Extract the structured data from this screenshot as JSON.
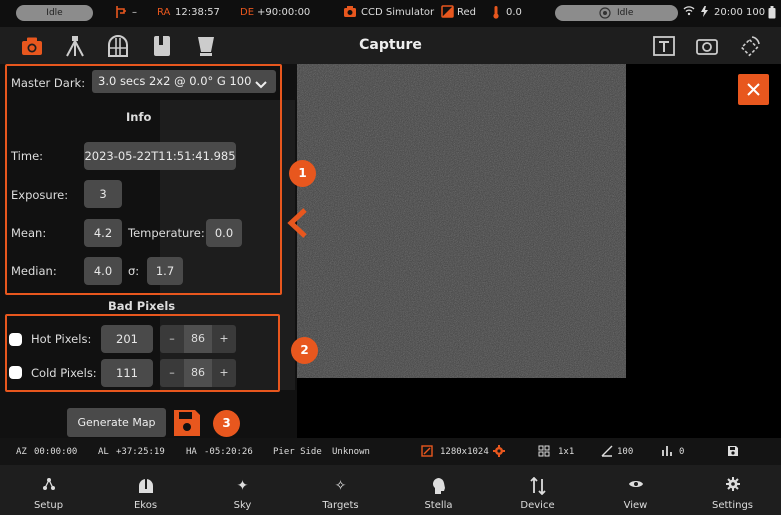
{
  "status": {
    "mount_state": "Idle",
    "ra_label": "RA",
    "ra_value": "12:38:57",
    "de_label": "DE",
    "de_value": "+90:00:00",
    "mount_dash": "–",
    "camera_name": "CCD Simulator",
    "filter_name": "Red",
    "temperature": "0.0",
    "guide_state": "Idle",
    "clock": "20:00",
    "battery": "100"
  },
  "nav": {
    "title": "Capture"
  },
  "panel": {
    "master_dark_label": "Master Dark:",
    "master_dark_value": "3.0 secs 2x2 @ 0.0° G 100",
    "info_heading": "Info",
    "time_label": "Time:",
    "time_value": "2023-05-22T11:51:41.985",
    "exposure_label": "Exposure:",
    "exposure_value": "3",
    "mean_label": "Mean:",
    "mean_value": "4.2",
    "temperature_label": "Temperature:",
    "temperature_value": "0.0",
    "median_label": "Median:",
    "median_value": "4.0",
    "sigma_label": "σ:",
    "sigma_value": "1.7"
  },
  "bad_pixels": {
    "heading": "Bad Pixels",
    "hot_label": "Hot Pixels:",
    "hot_value": "201",
    "hot_step": "86",
    "cold_label": "Cold Pixels:",
    "cold_value": "111",
    "cold_step": "86",
    "minus": "–",
    "plus": "+"
  },
  "generate_label": "Generate Map",
  "badges": [
    "1",
    "2",
    "3"
  ],
  "infobar": {
    "az_label": "AZ",
    "az_value": "00:00:00",
    "al_label": "AL",
    "al_value": "+37:25:19",
    "ha_label": "HA",
    "ha_value": "-05:20:26",
    "pier_label": "Pier Side",
    "pier_value": "Unknown",
    "resolution": "1280x1024",
    "binning": "1x1",
    "gain": "100",
    "offset": "0"
  },
  "tabs": [
    "Setup",
    "Ekos",
    "Sky",
    "Targets",
    "Stella",
    "Device",
    "View",
    "Settings"
  ],
  "colors": {
    "accent": "#e8571e",
    "panel": "#1e1e1e",
    "field": "#4a4a4a"
  }
}
